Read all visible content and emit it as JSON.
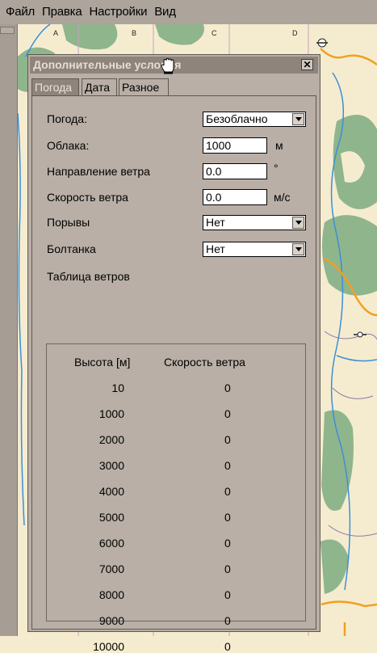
{
  "menu": [
    "Файл",
    "Правка",
    "Настройки",
    "Вид"
  ],
  "map": {
    "grid_labels": [
      "A",
      "B",
      "C",
      "D"
    ]
  },
  "dialog": {
    "title": "Дополнительные условия",
    "close_label": "✕",
    "tabs": [
      {
        "label": "Погода",
        "active": true
      },
      {
        "label": "Дата",
        "active": false
      },
      {
        "label": "Разное",
        "active": false
      }
    ],
    "fields": {
      "weather": {
        "label": "Погода:",
        "value": "Безоблачно"
      },
      "clouds": {
        "label": "Облака:",
        "value": "1000",
        "unit": "м"
      },
      "wind_dir": {
        "label": "Направление ветра",
        "value": "0.0",
        "unit": "°"
      },
      "wind_speed": {
        "label": "Скорость ветра",
        "value": "0.0",
        "unit": "м/с"
      },
      "gusts": {
        "label": "Порывы",
        "value": "Нет"
      },
      "turbulence": {
        "label": "Болтанка",
        "value": "Нет"
      }
    },
    "wind_table": {
      "title": "Таблица ветров",
      "headers": [
        "Высота [м]",
        "Скорость ветра"
      ],
      "rows": [
        {
          "height": "10",
          "speed": "0"
        },
        {
          "height": "1000",
          "speed": "0"
        },
        {
          "height": "2000",
          "speed": "0"
        },
        {
          "height": "3000",
          "speed": "0"
        },
        {
          "height": "4000",
          "speed": "0"
        },
        {
          "height": "5000",
          "speed": "0"
        },
        {
          "height": "6000",
          "speed": "0"
        },
        {
          "height": "7000",
          "speed": "0"
        },
        {
          "height": "8000",
          "speed": "0"
        },
        {
          "height": "9000",
          "speed": "0"
        },
        {
          "height": "10000",
          "speed": "0"
        }
      ]
    }
  },
  "colors": {
    "map_bg": "#f5ecd0",
    "forest": "#8fb58c",
    "water": "#3b8fd6",
    "road": "#f0a020",
    "dialog_bg": "#b9afa6",
    "title_bg": "#8e847b"
  }
}
